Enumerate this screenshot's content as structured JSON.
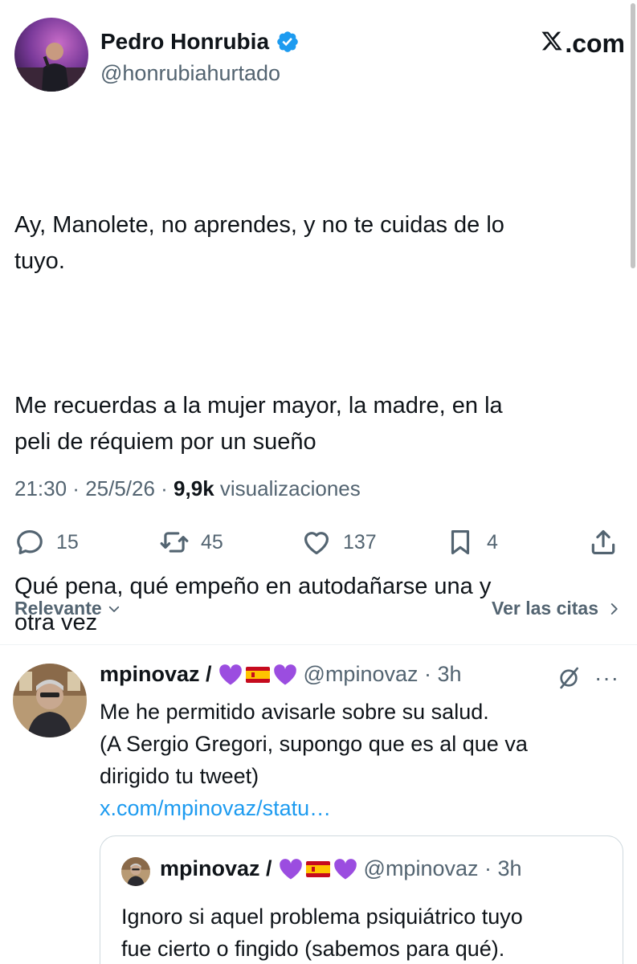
{
  "author": {
    "name": "Pedro Honrubia",
    "handle": "@honrubiahurtado"
  },
  "brand": {
    "site_suffix": ".com"
  },
  "tweet": {
    "paragraphs": [
      "Ay, Manolete, no aprendes, y no te cuidas de lo\ntuyo.",
      "Me recuerdas a la mujer mayor, la madre, en la\npeli de réquiem por un sueño",
      "Qué pena, qué empeño en autodañarse una y\notra vez"
    ],
    "time": "21:30",
    "date": "25/5/26",
    "views_count": "9,9k",
    "views_label": "visualizaciones",
    "separator": " · "
  },
  "actions": {
    "replies": "15",
    "retweets": "45",
    "likes": "137",
    "bookmarks": "4"
  },
  "sort": {
    "label": "Relevante",
    "quotes_link": "Ver las citas"
  },
  "reply": {
    "name": "mpinovaz /",
    "handle": "@mpinovaz",
    "time": "3h",
    "text": "Me he permitido avisarle sobre su salud.\n(A Sergio Gregori, supongo que es al que va\ndirigido tu tweet)",
    "link": "x.com/mpinovaz/statu…",
    "more": "···"
  },
  "quote": {
    "name": "mpinovaz /",
    "handle": "@mpinovaz",
    "time": "3h",
    "text": "Ignoro si aquel problema psiquiátrico tuyo\nfue cierto o fingido (sabemos para qué)."
  },
  "colors": {
    "text": "#0f1419",
    "secondary": "#536471",
    "link": "#1d9bf0",
    "verified": "#1d9bf0",
    "heart_purple": "#9b4de0",
    "flag_red": "#c60b1e",
    "flag_yellow": "#ffc400"
  }
}
